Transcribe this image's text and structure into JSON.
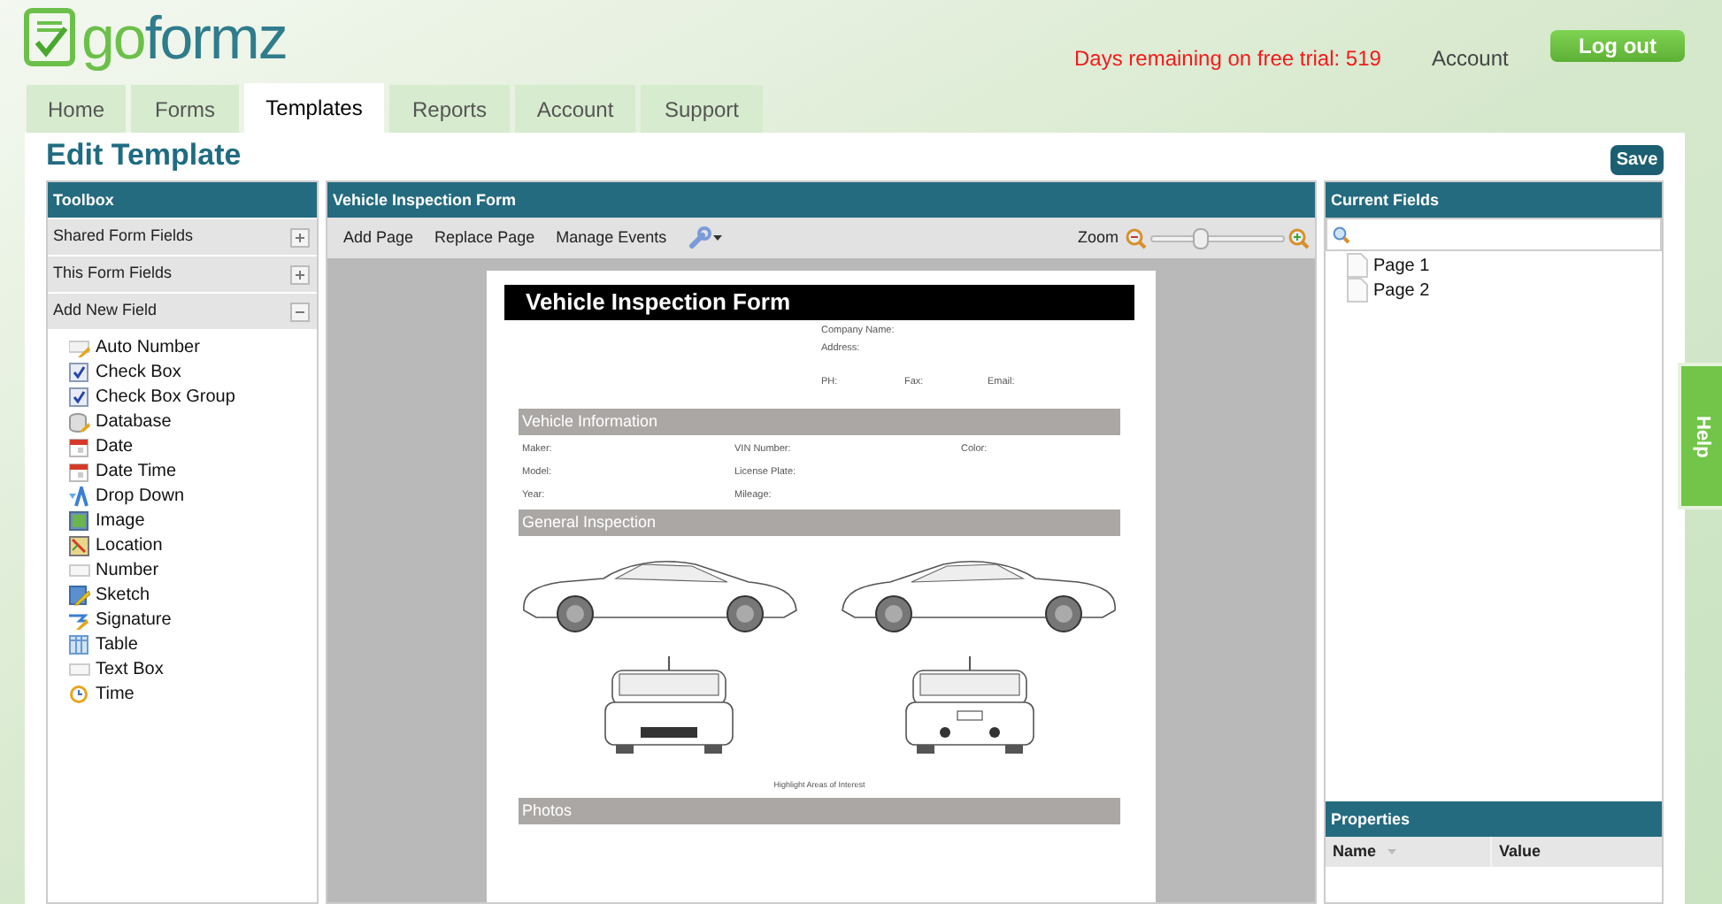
{
  "logo": [
    "go",
    "formz"
  ],
  "header": {
    "trial_notice": "Days remaining on free trial: 519",
    "account_link": "Account",
    "logout_button": "Log out"
  },
  "tabs": [
    {
      "label": "Home",
      "selected": false
    },
    {
      "label": "Forms",
      "selected": false
    },
    {
      "label": "Templates",
      "selected": true
    },
    {
      "label": "Reports",
      "selected": false
    },
    {
      "label": "Account",
      "selected": false
    },
    {
      "label": "Support",
      "selected": false
    }
  ],
  "page_title": "Edit Template",
  "save_button": "Save",
  "toolbox": {
    "title": "Toolbox",
    "sections": [
      {
        "label": "Shared Form Fields",
        "expanded": false
      },
      {
        "label": "This Form Fields",
        "expanded": false
      },
      {
        "label": "Add New Field",
        "expanded": true
      }
    ],
    "fields": [
      {
        "label": "Auto Number",
        "kind": "autonumber"
      },
      {
        "label": "Check Box",
        "kind": "checkbox"
      },
      {
        "label": "Check Box Group",
        "kind": "checkbox"
      },
      {
        "label": "Database",
        "kind": "database"
      },
      {
        "label": "Date",
        "kind": "calendar"
      },
      {
        "label": "Date Time",
        "kind": "calendar"
      },
      {
        "label": "Drop Down",
        "kind": "dropdown"
      },
      {
        "label": "Image",
        "kind": "image"
      },
      {
        "label": "Location",
        "kind": "map"
      },
      {
        "label": "Number",
        "kind": "textfield"
      },
      {
        "label": "Sketch",
        "kind": "sketch"
      },
      {
        "label": "Signature",
        "kind": "signature"
      },
      {
        "label": "Table",
        "kind": "table"
      },
      {
        "label": "Text Box",
        "kind": "textfield"
      },
      {
        "label": "Time",
        "kind": "clock"
      }
    ]
  },
  "editor": {
    "title": "Vehicle Inspection Form",
    "toolbar": [
      "Add Page",
      "Replace Page",
      "Manage Events"
    ],
    "zoom": {
      "label": "Zoom",
      "level": 0.37
    },
    "form_page": {
      "title": "Vehicle Inspection Form",
      "company_fields": [
        "Company Name:",
        "Address:"
      ],
      "contact_fields": [
        "PH:",
        "Fax:",
        "Email:"
      ],
      "sections": [
        {
          "title": "Vehicle Information",
          "kind": "fields",
          "rows": [
            [
              "Maker:",
              "VIN Number:",
              "Color:"
            ],
            [
              "Model:",
              "License Plate:"
            ],
            [
              "Year:",
              "Mileage:"
            ]
          ]
        },
        {
          "title": "General Inspection",
          "kind": "diagram",
          "caption": "Highlight Areas of Interest"
        },
        {
          "title": "Photos",
          "kind": "blank"
        }
      ]
    }
  },
  "current_fields": {
    "title": "Current Fields",
    "pages": [
      "Page 1",
      "Page 2"
    ]
  },
  "properties": {
    "title": "Properties",
    "columns": [
      "Name",
      "Value"
    ]
  },
  "help_tab": "Help"
}
